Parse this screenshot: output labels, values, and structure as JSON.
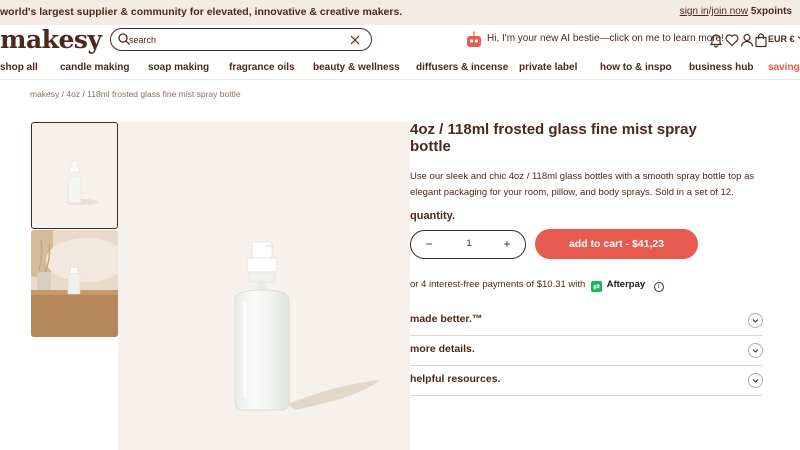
{
  "topbar": {
    "promo": "world's largest supplier & community for elevated, innovative & creative makers.",
    "sign_in": "sign in",
    "separator": "/",
    "join_now": "join now",
    "points": "5xpoints"
  },
  "header": {
    "logo": "makesy",
    "search": {
      "placeholder": "search",
      "value": ""
    },
    "ai_text": "Hi, I'm your new AI bestie—click on me to learn more!",
    "currency": "EUR €",
    "icons": [
      "bell-icon",
      "heart-icon",
      "account-icon",
      "cart-icon",
      "currency-chevron-icon"
    ]
  },
  "nav": {
    "items": [
      "shop all",
      "candle making",
      "soap making",
      "fragrance oils",
      "beauty & wellness",
      "diffusers & incense",
      "private label",
      "how to & inspo",
      "business hub",
      "savings"
    ]
  },
  "breadcrumb": "makesy / 4oz / 118ml frosted glass fine mist spray bottle",
  "product": {
    "title": "4oz / 118ml frosted glass fine mist spray bottle",
    "description": "Use our sleek and chic 4oz / 118ml glass bottles with a smooth spray bottle top as elegant packaging for your room, pillow, and body sprays. Sold in a set of 12.",
    "quantity_label": "quantity.",
    "quantity_value": "1",
    "minus": "−",
    "plus": "+",
    "add_to_cart": "add to cart  - $41,23",
    "afterpay": {
      "text": "or 4 interest-free payments of $10.31 with",
      "brand": "Afterpay",
      "logo_glyph": "⇄",
      "info_glyph": "i"
    },
    "accordions": [
      "made better.™",
      "more details.",
      "helpful resources."
    ]
  },
  "colors": {
    "brown": "#4a2a1e",
    "accent": "#e8594f",
    "topbar_bg": "#f4ebe3",
    "image_bg": "#f6f1ec",
    "afterpay_green": "#15b85a"
  }
}
